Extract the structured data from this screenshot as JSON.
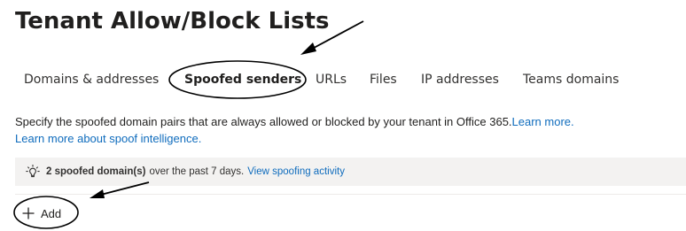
{
  "page": {
    "title": "Tenant Allow/Block Lists"
  },
  "tabs": [
    {
      "label": "Domains & addresses",
      "active": false
    },
    {
      "label": "Spoofed senders",
      "active": true
    },
    {
      "label": "URLs",
      "active": false
    },
    {
      "label": "Files",
      "active": false
    },
    {
      "label": "IP addresses",
      "active": false
    },
    {
      "label": "Teams domains",
      "active": false
    }
  ],
  "description": {
    "text": "Specify the spoofed domain pairs that are always allowed or blocked by your tenant in Office 365.",
    "learn_more_link": "Learn more.",
    "spoof_link": "Learn more about spoof intelligence."
  },
  "info_bar": {
    "icon": "lightbulb-icon",
    "count_text": "2 spoofed domain(s)",
    "period_text": "over the past 7 days.",
    "link_text": "View spoofing activity"
  },
  "toolbar": {
    "add_label": "Add",
    "add_icon": "plus-icon"
  },
  "colors": {
    "link": "#0f6cbd",
    "info_bar_bg": "#f3f2f1",
    "text": "#201f1e"
  }
}
